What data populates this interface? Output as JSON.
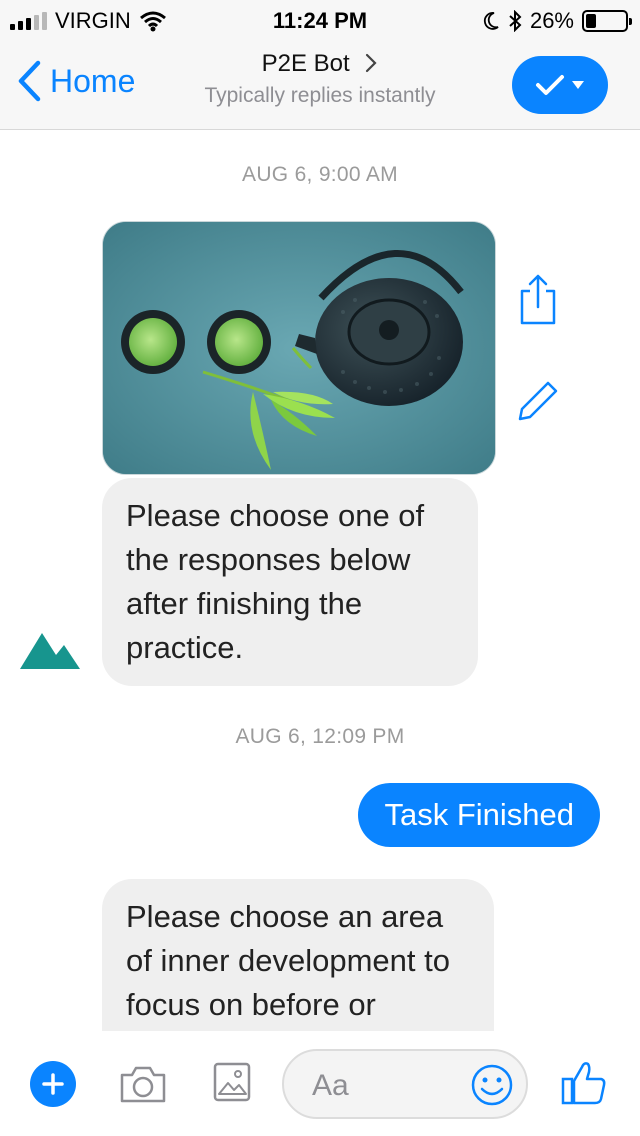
{
  "status_bar": {
    "carrier": "VIRGIN",
    "time": "11:24 PM",
    "battery_percent": "26%",
    "battery_level": 0.26
  },
  "nav": {
    "back_label": "Home",
    "title": "P2E Bot",
    "subtitle": "Typically replies instantly",
    "accent": "#0a84ff"
  },
  "chat": {
    "timestamp_1": "AUG 6, 9:00 AM",
    "bot_message_1": "Please choose one of the responses below after finishing the practice.",
    "timestamp_2": "AUG 6, 12:09 PM",
    "user_message_1": "Task Finished",
    "bot_message_2": "Please choose an area of inner development to focus on before or"
  },
  "composer": {
    "placeholder": "Aa"
  },
  "icons": [
    "wifi-icon",
    "moon-icon",
    "bluetooth-icon",
    "chevron-left-icon",
    "chevron-right-icon",
    "checkmark-icon",
    "caret-down-icon",
    "share-icon",
    "pencil-icon",
    "bot-avatar-mountain-icon",
    "plus-icon",
    "camera-icon",
    "gallery-icon",
    "emoji-icon",
    "thumbs-up-icon"
  ]
}
